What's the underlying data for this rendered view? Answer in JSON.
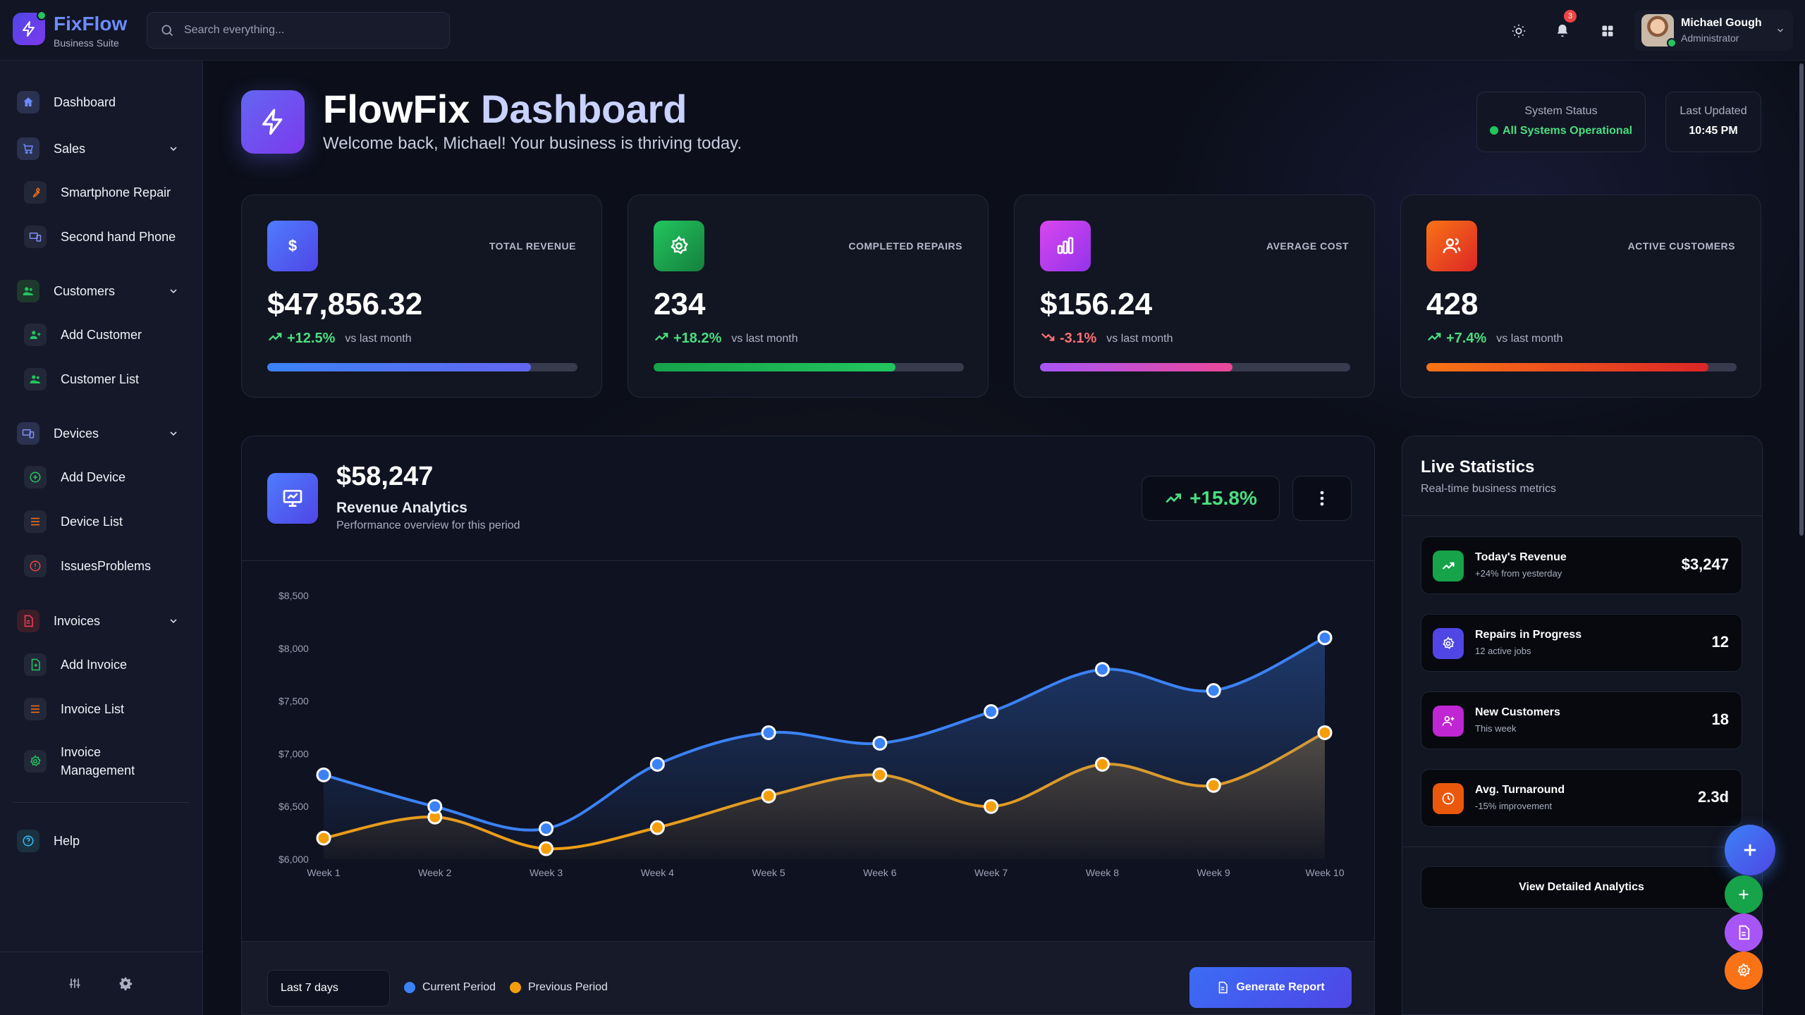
{
  "app": {
    "brand": "FixFlow",
    "brand_sub": "Business Suite"
  },
  "search": {
    "placeholder": "Search everything..."
  },
  "topbar": {
    "notification_count": "3",
    "user_name": "Michael Gough",
    "user_role": "Administrator"
  },
  "sidebar": {
    "dashboard": "Dashboard",
    "sales": "Sales",
    "smartphone_repair": "Smartphone Repair",
    "second_hand_phone": "Second hand Phone",
    "customers": "Customers",
    "add_customer": "Add Customer",
    "customer_list": "Customer List",
    "devices": "Devices",
    "add_device": "Add Device",
    "device_list": "Device List",
    "issues_problems": "IssuesProblems",
    "invoices": "Invoices",
    "add_invoice": "Add Invoice",
    "invoice_list": "Invoice List",
    "invoice_management_1": "Invoice",
    "invoice_management_2": "Management",
    "help": "Help"
  },
  "hero": {
    "title_a": "FlowFix",
    "title_b": "Dashboard",
    "subtitle": "Welcome back, Michael! Your business is thriving today."
  },
  "status": {
    "label": "System Status",
    "value": "All Systems Operational",
    "updated_label": "Last Updated",
    "updated_value": "10:45 PM"
  },
  "kpis": [
    {
      "label": "TOTAL REVENUE",
      "value": "$47,856.32",
      "change": "+12.5%",
      "vs": "vs last month",
      "progress": 0.85,
      "icon": "dollar-icon",
      "trend": "up"
    },
    {
      "label": "COMPLETED REPAIRS",
      "value": "234",
      "change": "+18.2%",
      "vs": "vs last month",
      "progress": 0.78,
      "icon": "gear-icon",
      "trend": "up"
    },
    {
      "label": "AVERAGE COST",
      "value": "$156.24",
      "change": "-3.1%",
      "vs": "vs last month",
      "progress": 0.62,
      "icon": "bar-chart-icon",
      "trend": "down"
    },
    {
      "label": "ACTIVE CUSTOMERS",
      "value": "428",
      "change": "+7.4%",
      "vs": "vs last month",
      "progress": 0.91,
      "icon": "users-icon",
      "trend": "up"
    }
  ],
  "revenue": {
    "amount": "$58,247",
    "title": "Revenue Analytics",
    "subtitle": "Performance overview for this period",
    "change": "+15.8%",
    "range": "Last 7 days",
    "legend_current": "Current Period",
    "legend_previous": "Previous Period",
    "button": "Generate Report"
  },
  "chart_data": {
    "type": "line",
    "categories": [
      "Week 1",
      "Week 2",
      "Week 3",
      "Week 4",
      "Week 5",
      "Week 6",
      "Week 7",
      "Week 8",
      "Week 9",
      "Week 10"
    ],
    "series": [
      {
        "name": "Current Period",
        "color": "#3b82f6",
        "values": [
          6800,
          6500,
          6290,
          6900,
          7200,
          7100,
          7400,
          7800,
          7600,
          8100
        ]
      },
      {
        "name": "Previous Period",
        "color": "#f59e0b",
        "values": [
          6200,
          6400,
          6100,
          6300,
          6600,
          6800,
          6500,
          6900,
          6700,
          7200
        ]
      }
    ],
    "ylim": [
      6000,
      8500
    ],
    "yticks": [
      "$6,000",
      "$6,500",
      "$7,000",
      "$7,500",
      "$8,000",
      "$8,500"
    ],
    "grid": false
  },
  "live": {
    "title": "Live Statistics",
    "subtitle": "Real-time business metrics",
    "rows": [
      {
        "name": "Today's Revenue",
        "desc": "+24% from yesterday",
        "value": "$3,247",
        "icon": "trend-up-icon",
        "color": "#16a34a"
      },
      {
        "name": "Repairs in Progress",
        "desc": "12 active jobs",
        "value": "12",
        "icon": "gear-icon",
        "color": "#4f46e5"
      },
      {
        "name": "New Customers",
        "desc": "This week",
        "value": "18",
        "icon": "user-add-icon",
        "color": "#c026d3"
      },
      {
        "name": "Avg. Turnaround",
        "desc": "-15% improvement",
        "value": "2.3d",
        "icon": "clock-icon",
        "color": "#ea580c"
      }
    ],
    "button": "View Detailed Analytics"
  }
}
